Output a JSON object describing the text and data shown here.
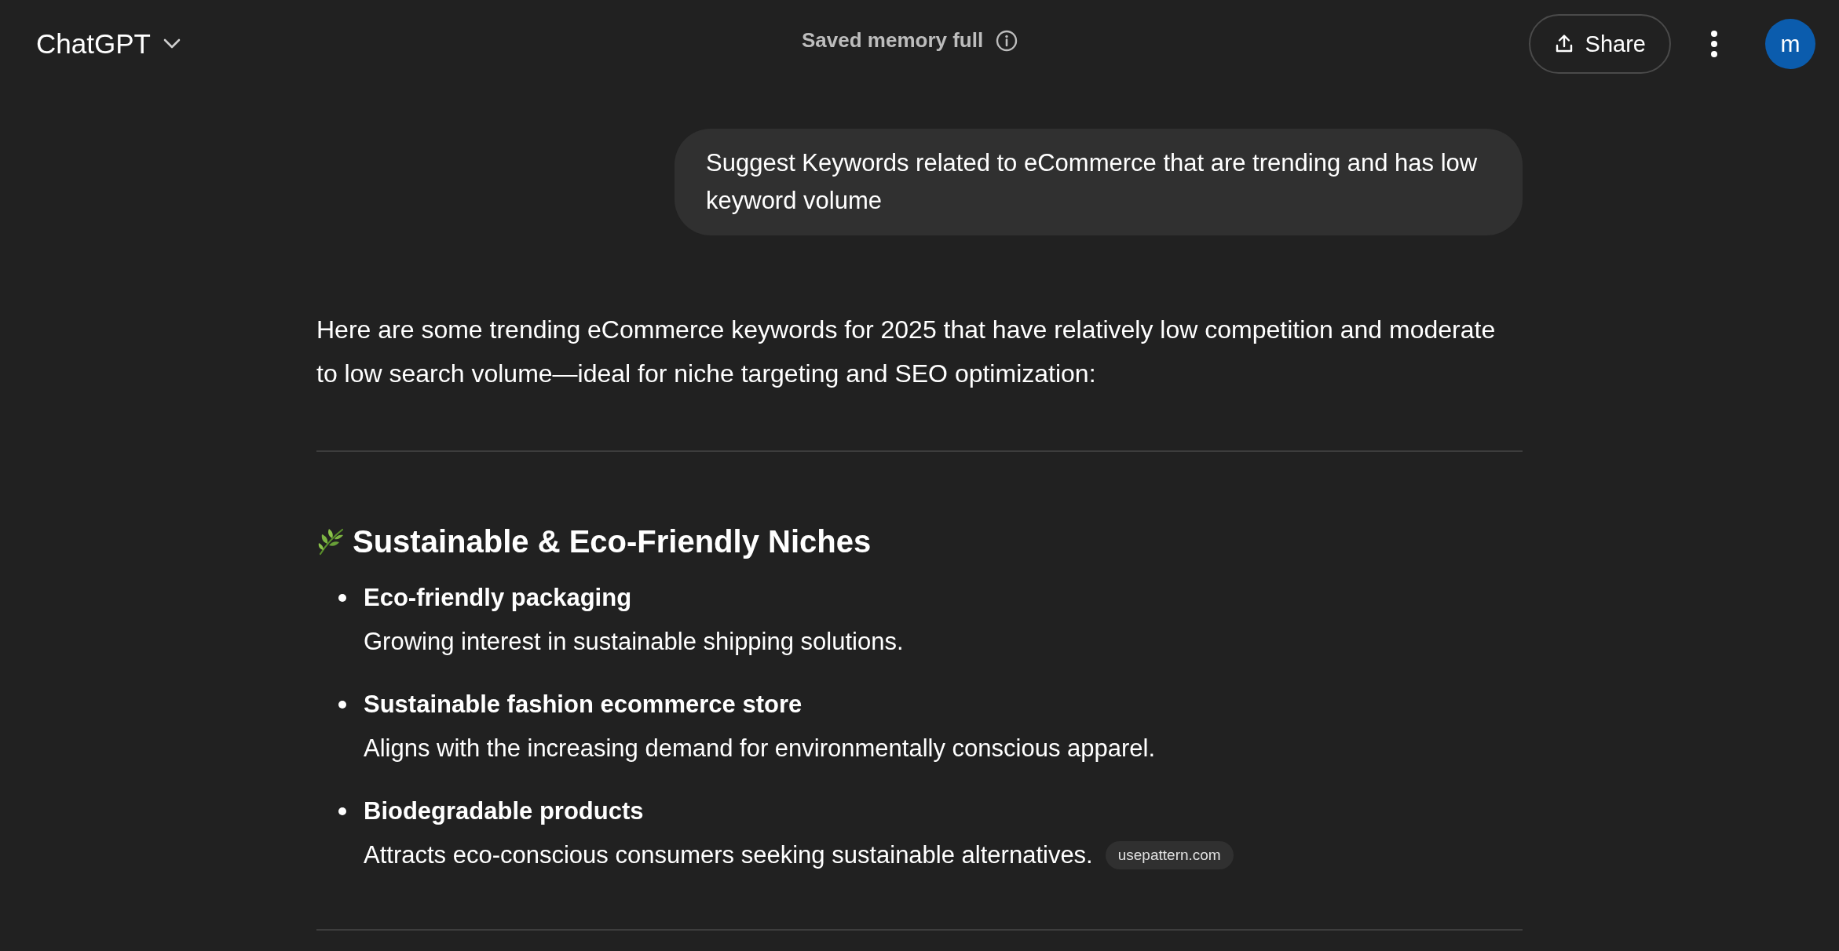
{
  "header": {
    "title": "ChatGPT",
    "memory_status": "Saved memory full",
    "share_label": "Share",
    "avatar_letter": "m"
  },
  "user_message": "Suggest Keywords related to eCommerce that are trending and has low keyword volume",
  "response": {
    "intro": "Here are some trending eCommerce keywords for 2025 that have relatively low competition and moderate to low search volume—ideal for niche targeting and SEO optimization:",
    "section": {
      "heading": "Sustainable & Eco-Friendly Niches",
      "items": [
        {
          "keyword": "Eco-friendly packaging",
          "description": "Growing interest in sustainable shipping solutions."
        },
        {
          "keyword": "Sustainable fashion ecommerce store",
          "description": "Aligns with the increasing demand for environmentally conscious apparel."
        },
        {
          "keyword": "Biodegradable products",
          "description": "Attracts eco-conscious consumers seeking sustainable alternatives.",
          "citation": "usepattern.com"
        }
      ]
    }
  }
}
